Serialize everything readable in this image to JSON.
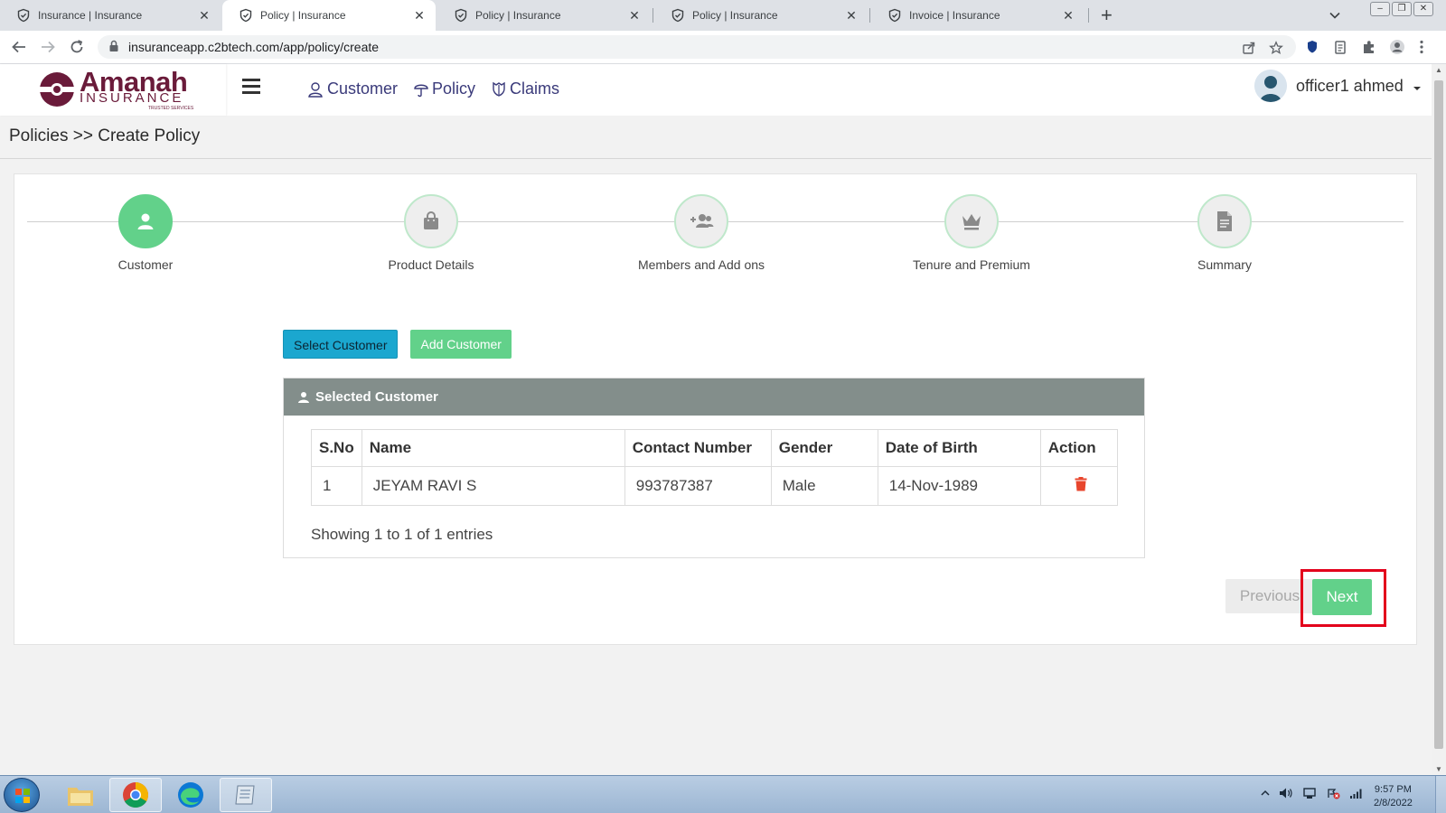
{
  "browser": {
    "tabs": [
      {
        "title": "Insurance | Insurance",
        "active": false
      },
      {
        "title": "Policy | Insurance",
        "active": true
      },
      {
        "title": "Policy | Insurance",
        "active": false
      },
      {
        "title": "Policy | Insurance",
        "active": false
      },
      {
        "title": "Invoice | Insurance",
        "active": false
      }
    ],
    "close_glyph": "✕",
    "new_tab_glyph": "+",
    "url": "insuranceapp.c2btech.com/app/policy/create"
  },
  "header": {
    "logo_word": "Amanah",
    "logo_sub": "INSURANCE",
    "logo_tag": "TRUSTED SERVICES",
    "nav": [
      {
        "label": "Customer",
        "icon": "user-outline-icon"
      },
      {
        "label": "Policy",
        "icon": "umbrella-icon"
      },
      {
        "label": "Claims",
        "icon": "shield-icon"
      }
    ],
    "user_name": "officer1 ahmed"
  },
  "breadcrumb": "Policies >> Create Policy",
  "steps": [
    {
      "label": "Customer",
      "icon": "user-icon",
      "active": true
    },
    {
      "label": "Product Details",
      "icon": "shopping-bag-icon",
      "active": false
    },
    {
      "label": "Members and Add ons",
      "icon": "user-plus-icon",
      "active": false
    },
    {
      "label": "Tenure and Premium",
      "icon": "crown-icon",
      "active": false
    },
    {
      "label": "Summary",
      "icon": "document-icon",
      "active": false
    }
  ],
  "buttons": {
    "select_customer": "Select Customer",
    "add_customer": "Add Customer",
    "previous": "Previous",
    "next": "Next"
  },
  "panel": {
    "title": "Selected Customer",
    "columns": [
      "S.No",
      "Name",
      "Contact Number",
      "Gender",
      "Date of Birth",
      "Action"
    ],
    "rows": [
      {
        "sno": "1",
        "name": "JEYAM RAVI S",
        "contact": "993787387",
        "gender": "Male",
        "dob": "14-Nov-1989"
      }
    ],
    "entries": "Showing 1 to 1 of 1 entries"
  },
  "taskbar": {
    "time": "9:57 PM",
    "date": "2/8/2022"
  },
  "colors": {
    "brand": "#6a1b3a",
    "accent_green": "#62d18a",
    "accent_blue": "#1ba7cf",
    "panel_header": "#838e8b",
    "delete_red": "#e8452c",
    "highlight_frame": "#e3001b"
  }
}
